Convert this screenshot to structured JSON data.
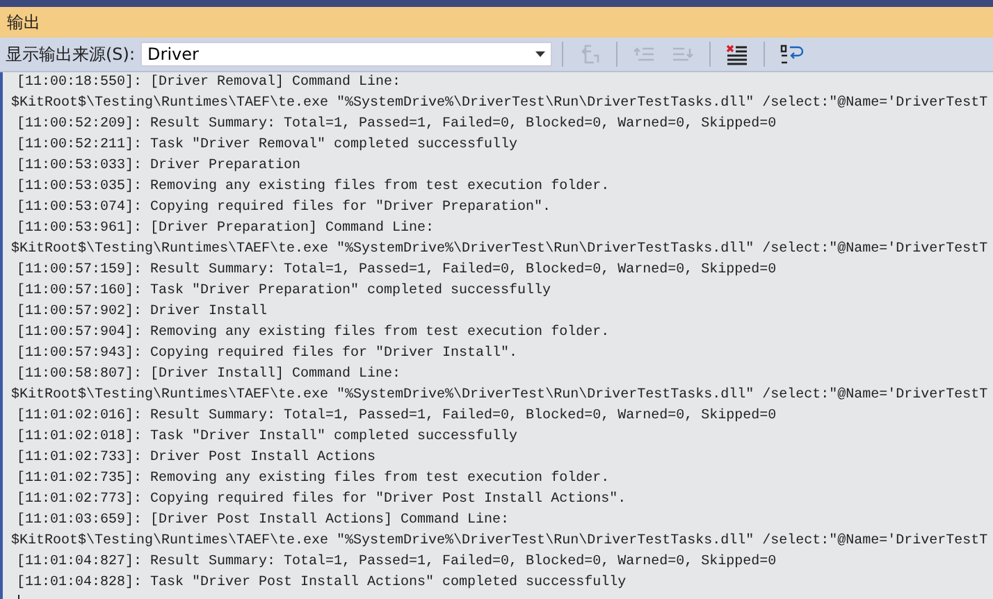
{
  "panel": {
    "title": "输出"
  },
  "toolbar": {
    "source_label": "显示输出来源(S):",
    "source_value": "Driver",
    "buttons": [
      {
        "kind": "goto",
        "disabled": true
      },
      {
        "kind": "prev",
        "disabled": true
      },
      {
        "kind": "next",
        "disabled": true
      },
      {
        "kind": "clear",
        "disabled": false
      },
      {
        "kind": "wrap",
        "disabled": false
      }
    ]
  },
  "output_lines": [
    {
      "kind": "log",
      "text": "[11:00:18:550]: [Driver Removal] Command Line:"
    },
    {
      "kind": "command",
      "text": "$KitRoot$\\Testing\\Runtimes\\TAEF\\te.exe \"%SystemDrive%\\DriverTest\\Run\\DriverTestTasks.dll\" /select:\"@Name='DriverTestT"
    },
    {
      "kind": "log",
      "text": "[11:00:52:209]: Result Summary: Total=1, Passed=1, Failed=0, Blocked=0, Warned=0, Skipped=0"
    },
    {
      "kind": "log",
      "text": "[11:00:52:211]: Task \"Driver Removal\" completed successfully"
    },
    {
      "kind": "log",
      "text": "[11:00:53:033]: Driver Preparation"
    },
    {
      "kind": "log",
      "text": "[11:00:53:035]: Removing any existing files from test execution folder."
    },
    {
      "kind": "log",
      "text": "[11:00:53:074]: Copying required files for \"Driver Preparation\"."
    },
    {
      "kind": "log",
      "text": "[11:00:53:961]: [Driver Preparation] Command Line:"
    },
    {
      "kind": "command",
      "text": "$KitRoot$\\Testing\\Runtimes\\TAEF\\te.exe \"%SystemDrive%\\DriverTest\\Run\\DriverTestTasks.dll\" /select:\"@Name='DriverTestT"
    },
    {
      "kind": "log",
      "text": "[11:00:57:159]: Result Summary: Total=1, Passed=1, Failed=0, Blocked=0, Warned=0, Skipped=0"
    },
    {
      "kind": "log",
      "text": "[11:00:57:160]: Task \"Driver Preparation\" completed successfully"
    },
    {
      "kind": "log",
      "text": "[11:00:57:902]: Driver Install"
    },
    {
      "kind": "log",
      "text": "[11:00:57:904]: Removing any existing files from test execution folder."
    },
    {
      "kind": "log",
      "text": "[11:00:57:943]: Copying required files for \"Driver Install\"."
    },
    {
      "kind": "log",
      "text": "[11:00:58:807]: [Driver Install] Command Line:"
    },
    {
      "kind": "command",
      "text": "$KitRoot$\\Testing\\Runtimes\\TAEF\\te.exe \"%SystemDrive%\\DriverTest\\Run\\DriverTestTasks.dll\" /select:\"@Name='DriverTestT"
    },
    {
      "kind": "log",
      "text": "[11:01:02:016]: Result Summary: Total=1, Passed=1, Failed=0, Blocked=0, Warned=0, Skipped=0"
    },
    {
      "kind": "log",
      "text": "[11:01:02:018]: Task \"Driver Install\" completed successfully"
    },
    {
      "kind": "log",
      "text": "[11:01:02:733]: Driver Post Install Actions"
    },
    {
      "kind": "log",
      "text": "[11:01:02:735]: Removing any existing files from test execution folder."
    },
    {
      "kind": "log",
      "text": "[11:01:02:773]: Copying required files for \"Driver Post Install Actions\"."
    },
    {
      "kind": "log",
      "text": "[11:01:03:659]: [Driver Post Install Actions] Command Line:"
    },
    {
      "kind": "command",
      "text": "$KitRoot$\\Testing\\Runtimes\\TAEF\\te.exe \"%SystemDrive%\\DriverTest\\Run\\DriverTestTasks.dll\" /select:\"@Name='DriverTestT"
    },
    {
      "kind": "log",
      "text": "[11:01:04:827]: Result Summary: Total=1, Passed=1, Failed=0, Blocked=0, Warned=0, Skipped=0"
    },
    {
      "kind": "log",
      "text": "[11:01:04:828]: Task \"Driver Post Install Actions\" completed successfully"
    }
  ]
}
